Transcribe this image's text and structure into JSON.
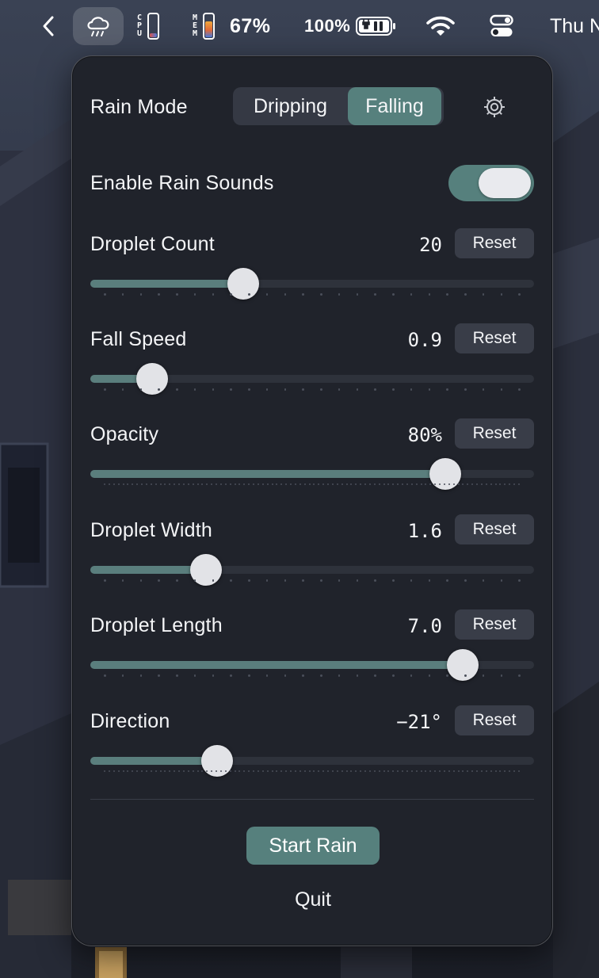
{
  "menubar": {
    "cpu_label": "CPU",
    "mem_label": "MEM",
    "mem_percent": "67%",
    "battery_percent": "100%",
    "clock": "Thu N"
  },
  "panel": {
    "mode_label": "Rain Mode",
    "mode_options": [
      "Dripping",
      "Falling"
    ],
    "mode_selected": "Falling",
    "sounds_label": "Enable Rain Sounds",
    "sounds_enabled": true,
    "reset_label": "Reset",
    "sliders": [
      {
        "label": "Droplet Count",
        "value": "20",
        "fraction": 0.345
      },
      {
        "label": "Fall Speed",
        "value": "0.9",
        "fraction": 0.14
      },
      {
        "label": "Opacity",
        "value": "80%",
        "fraction": 0.8
      },
      {
        "label": "Droplet Width",
        "value": "1.6",
        "fraction": 0.26
      },
      {
        "label": "Droplet Length",
        "value": "7.0",
        "fraction": 0.84
      },
      {
        "label": "Direction",
        "value": "−21°",
        "fraction": 0.285
      }
    ],
    "start_label": "Start Rain",
    "quit_label": "Quit"
  },
  "colors": {
    "accent": "#56807d",
    "panel_bg": "#20232b",
    "reset_bg": "#393d48"
  }
}
